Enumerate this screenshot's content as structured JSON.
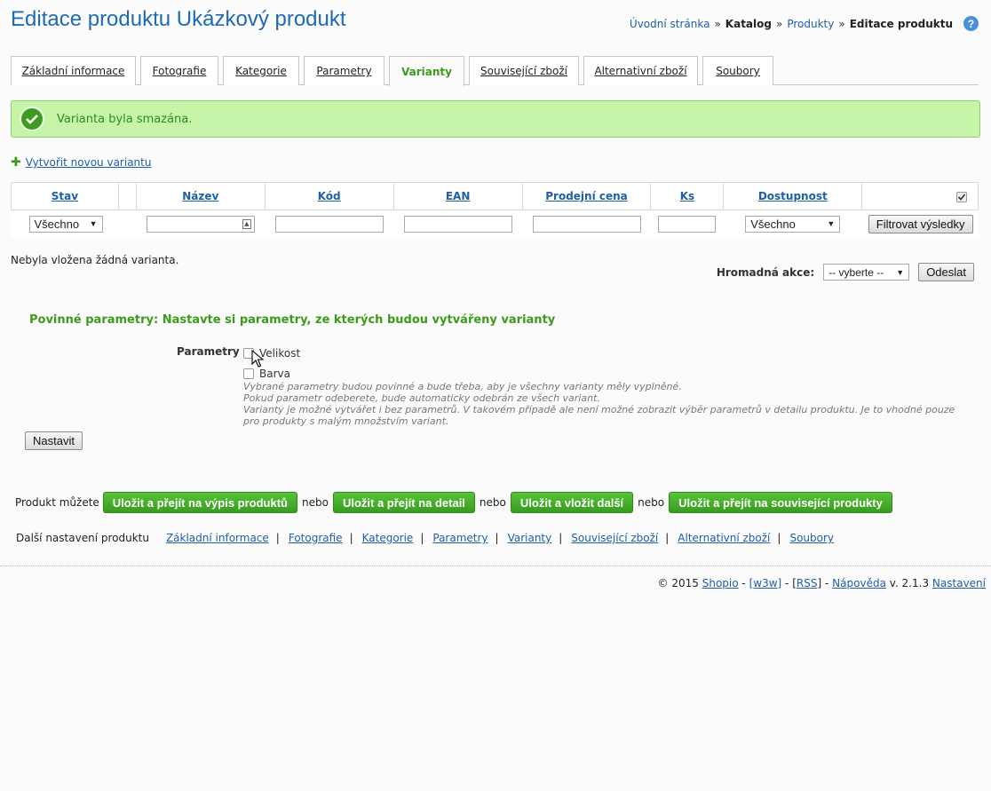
{
  "header": {
    "title": "Editace produktu Ukázkový produkt",
    "breadcrumb": [
      "Úvodní stránka",
      "Katalog",
      "Produkty",
      "Editace produktu"
    ],
    "separator": "»",
    "help": "?"
  },
  "tabs": [
    "Základní informace",
    "Fotografie",
    "Kategorie",
    "Parametry",
    "Varianty",
    "Související zboží",
    "Alternativní zboží",
    "Soubory"
  ],
  "active_tab": "Varianty",
  "success_message": "Varianta byla smazána.",
  "create_link": "Vytvořit novou variantu",
  "table": {
    "columns": [
      "Stav",
      "",
      "Název",
      "Kód",
      "EAN",
      "Prodejní cena",
      "Ks",
      "Dostupnost",
      ""
    ],
    "filter_stav": "Všechno",
    "filter_dostupnost": "Všechno",
    "filter_button": "Filtrovat výsledky"
  },
  "empty_message": "Nebyla vložena žádná varianta.",
  "bulk": {
    "label": "Hromadná akce:",
    "select_value": "-- vyberte --",
    "submit": "Odeslat"
  },
  "required_params": {
    "title": "Povinné parametry: Nastavte si parametry, ze kterých budou vytvářeny varianty",
    "label": "Parametry",
    "options": [
      "Velikost",
      "Barva"
    ],
    "hints": [
      "Vybrané parametry budou povinné a bude třeba, aby je všechny varianty měly vyplněné.",
      "Pokud parametr odeberete, bude automaticky odebrán ze všech variant.",
      "Varianty je možné vytvářet i bez parametrů. V takovém případě ale není možné zobrazit výběr parametrů v detailu produktu. Je to vhodné pouze pro produkty s malým množstvím variant."
    ],
    "submit": "Nastavit"
  },
  "save": {
    "intro": "Produkt můžete",
    "or": "nebo",
    "buttons": [
      "Uložit a přejít na výpis produktů",
      "Uložit a přejít na detail",
      "Uložit a vložit další",
      "Uložit a přejít na související produkty"
    ]
  },
  "more": {
    "intro": "Další nastavení produktu",
    "links": [
      "Základní informace",
      "Fotografie",
      "Kategorie",
      "Parametry",
      "Varianty",
      "Související zboží",
      "Alternativní zboží",
      "Soubory"
    ],
    "separator": "|"
  },
  "footer": {
    "copyright": "© 2015",
    "brand": "Shopio",
    "w3w": "[w3w]",
    "rss": "RSS",
    "help": "Nápověda",
    "version": "v. 2.1.3",
    "settings": "Nastavení",
    "dash": "-"
  },
  "colors": {
    "title": "#1f6ab3",
    "link": "#1e5fa8",
    "accent_green": "#3c9a1c",
    "success_bg": "#c6f5a9"
  }
}
